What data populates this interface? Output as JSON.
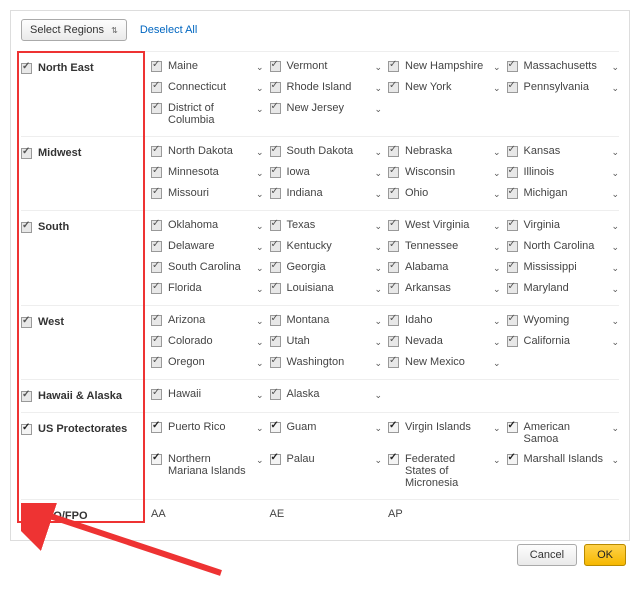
{
  "toolbar": {
    "select_regions_label": "Select Regions",
    "deselect_label": "Deselect All"
  },
  "regions": [
    {
      "id": "north-east",
      "label": "North East",
      "checked": true,
      "items": [
        {
          "label": "Maine",
          "checked": true,
          "chev": true
        },
        {
          "label": "Vermont",
          "checked": true,
          "chev": true
        },
        {
          "label": "New Hampshire",
          "checked": true,
          "chev": true
        },
        {
          "label": "Massachusetts",
          "checked": true,
          "chev": true
        },
        {
          "label": "Connecticut",
          "checked": true,
          "chev": true
        },
        {
          "label": "Rhode Island",
          "checked": true,
          "chev": true
        },
        {
          "label": "New York",
          "checked": true,
          "chev": true
        },
        {
          "label": "Pennsylvania",
          "checked": true,
          "chev": true
        },
        {
          "label": "District of Columbia",
          "checked": true,
          "chev": true,
          "chev_outside": true
        },
        {
          "label": "New Jersey",
          "checked": true,
          "chev": true
        }
      ]
    },
    {
      "id": "midwest",
      "label": "Midwest",
      "checked": true,
      "items": [
        {
          "label": "North Dakota",
          "checked": true,
          "chev": true
        },
        {
          "label": "South Dakota",
          "checked": true,
          "chev": true
        },
        {
          "label": "Nebraska",
          "checked": true,
          "chev": true
        },
        {
          "label": "Kansas",
          "checked": true,
          "chev": true
        },
        {
          "label": "Minnesota",
          "checked": true,
          "chev": true
        },
        {
          "label": "Iowa",
          "checked": true,
          "chev": true
        },
        {
          "label": "Wisconsin",
          "checked": true,
          "chev": true
        },
        {
          "label": "Illinois",
          "checked": true,
          "chev": true
        },
        {
          "label": "Missouri",
          "checked": true,
          "chev": true
        },
        {
          "label": "Indiana",
          "checked": true,
          "chev": true
        },
        {
          "label": "Ohio",
          "checked": true,
          "chev": true
        },
        {
          "label": "Michigan",
          "checked": true,
          "chev": true
        }
      ]
    },
    {
      "id": "south",
      "label": "South",
      "checked": true,
      "items": [
        {
          "label": "Oklahoma",
          "checked": true,
          "chev": true
        },
        {
          "label": "Texas",
          "checked": true,
          "chev": true
        },
        {
          "label": "West Virginia",
          "checked": true,
          "chev": true
        },
        {
          "label": "Virginia",
          "checked": true,
          "chev": true
        },
        {
          "label": "Delaware",
          "checked": true,
          "chev": true
        },
        {
          "label": "Kentucky",
          "checked": true,
          "chev": true
        },
        {
          "label": "Tennessee",
          "checked": true,
          "chev": true
        },
        {
          "label": "North Carolina",
          "checked": true,
          "chev": true
        },
        {
          "label": "South Carolina",
          "checked": true,
          "chev": true
        },
        {
          "label": "Georgia",
          "checked": true,
          "chev": true
        },
        {
          "label": "Alabama",
          "checked": true,
          "chev": true
        },
        {
          "label": "Mississippi",
          "checked": true,
          "chev": true
        },
        {
          "label": "Florida",
          "checked": true,
          "chev": true
        },
        {
          "label": "Louisiana",
          "checked": true,
          "chev": true
        },
        {
          "label": "Arkansas",
          "checked": true,
          "chev": true
        },
        {
          "label": "Maryland",
          "checked": true,
          "chev": true
        }
      ]
    },
    {
      "id": "west",
      "label": "West",
      "checked": true,
      "items": [
        {
          "label": "Arizona",
          "checked": true,
          "chev": true
        },
        {
          "label": "Montana",
          "checked": true,
          "chev": true
        },
        {
          "label": "Idaho",
          "checked": true,
          "chev": true
        },
        {
          "label": "Wyoming",
          "checked": true,
          "chev": true
        },
        {
          "label": "Colorado",
          "checked": true,
          "chev": true
        },
        {
          "label": "Utah",
          "checked": true,
          "chev": true
        },
        {
          "label": "Nevada",
          "checked": true,
          "chev": true
        },
        {
          "label": "California",
          "checked": true,
          "chev": true
        },
        {
          "label": "Oregon",
          "checked": true,
          "chev": true
        },
        {
          "label": "Washington",
          "checked": true,
          "chev": true
        },
        {
          "label": "New Mexico",
          "checked": true,
          "chev": true
        }
      ]
    },
    {
      "id": "hawaii-alaska",
      "label": "Hawaii & Alaska",
      "checked": true,
      "items": [
        {
          "label": "Hawaii",
          "checked": true,
          "chev": true
        },
        {
          "label": "Alaska",
          "checked": true,
          "chev": true
        }
      ]
    },
    {
      "id": "us-protectorates",
      "label": "US Protectorates",
      "checked": true,
      "strong": true,
      "items": [
        {
          "label": "Puerto Rico",
          "checked": true,
          "strong": true,
          "chev": true
        },
        {
          "label": "Guam",
          "checked": true,
          "strong": true,
          "chev": true
        },
        {
          "label": "Virgin Islands",
          "checked": true,
          "strong": true,
          "chev": true
        },
        {
          "label": "American Samoa",
          "checked": true,
          "strong": true,
          "chev": true
        },
        {
          "label": "Northern Mariana Islands",
          "checked": true,
          "strong": true,
          "chev": true,
          "chev_outside": true
        },
        {
          "label": "Palau",
          "checked": true,
          "strong": true,
          "chev": true
        },
        {
          "label": "Federated States of Micronesia",
          "checked": true,
          "strong": true,
          "chev": true,
          "chev_outside": true
        },
        {
          "label": "Marshall Islands",
          "checked": true,
          "strong": true,
          "chev": true
        }
      ]
    },
    {
      "id": "apo-fpo",
      "label": "APO/FPO",
      "checked": true,
      "strong": true,
      "items": [
        {
          "label": "AA",
          "checked": null
        },
        {
          "label": "AE",
          "checked": null
        },
        {
          "label": "AP",
          "checked": null
        }
      ]
    }
  ],
  "footer": {
    "cancel_label": "Cancel",
    "ok_label": "OK"
  },
  "annotation": {
    "highlight_color": "#e33"
  }
}
